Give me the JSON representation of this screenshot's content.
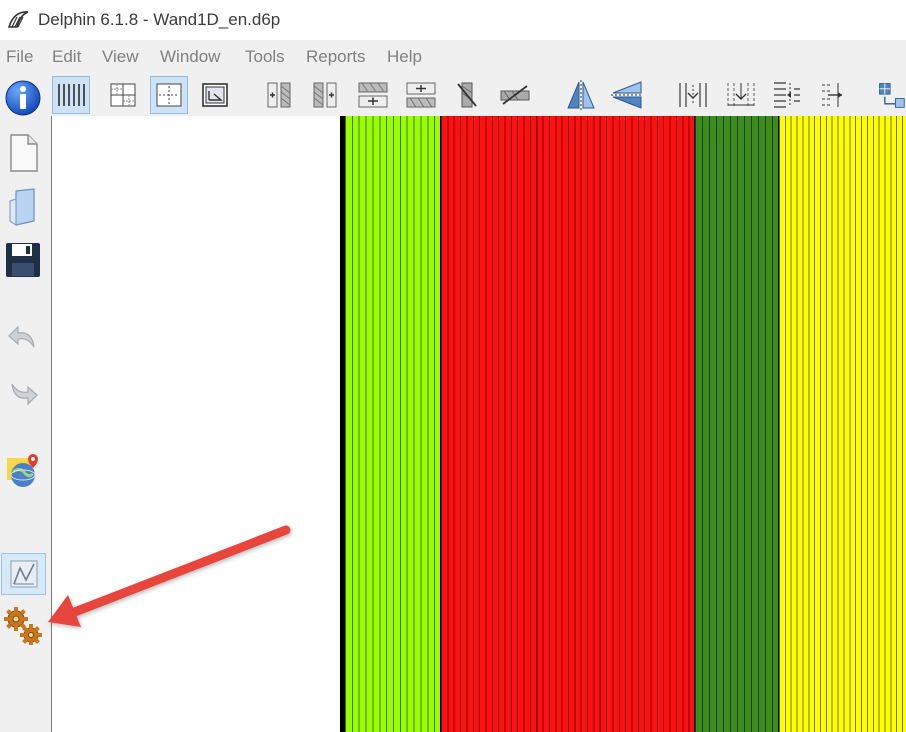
{
  "window": {
    "title": "Delphin 6.1.8 - Wand1D_en.d6p"
  },
  "menu": [
    "File",
    "Edit",
    "View",
    "Window",
    "Tools",
    "Reports",
    "Help"
  ],
  "left_toolbar": [
    {
      "icon": "info-icon"
    },
    {
      "icon": "new-file-icon"
    },
    {
      "icon": "open-file-icon"
    },
    {
      "icon": "save-icon"
    },
    {
      "icon": "undo-icon"
    },
    {
      "icon": "redo-icon"
    },
    {
      "icon": "climate-location-icon"
    },
    {
      "icon": "post-processing-icon",
      "checked": true
    },
    {
      "icon": "settings-gears-icon"
    }
  ],
  "top_toolbar": [
    {
      "icon": "grid-lines-view-icon",
      "checked": true
    },
    {
      "icon": "grid-cells-view-icon"
    },
    {
      "icon": "selection-view-icon",
      "checked": true
    },
    {
      "icon": "assignment-view-icon"
    },
    {
      "icon": "insert-column-icon"
    },
    {
      "icon": "split-column-icon"
    },
    {
      "icon": "insert-row-icon"
    },
    {
      "icon": "split-row-icon"
    },
    {
      "icon": "delete-column-icon"
    },
    {
      "icon": "delete-row-icon"
    },
    {
      "icon": "mirror-horizontal-icon"
    },
    {
      "icon": "mirror-vertical-icon"
    },
    {
      "icon": "refine-columns-icon"
    },
    {
      "icon": "refine-rows-icon"
    },
    {
      "icon": "align-left-icon"
    },
    {
      "icon": "align-right-icon"
    },
    {
      "icon": "more-tools-icon"
    }
  ],
  "layers": [
    {
      "name": "black-boundary-layer",
      "color": "#000000",
      "lines": 0
    },
    {
      "name": "light-green-layer",
      "color": "#99ff00",
      "lines": 14
    },
    {
      "name": "red-layer",
      "color": "#ff1010",
      "lines": 40
    },
    {
      "name": "dark-green-layer",
      "color": "#3c8c1e",
      "lines": 12
    },
    {
      "name": "yellow-layer",
      "color": "#ffff00",
      "lines": 22
    }
  ],
  "annotation": {
    "color": "#e8453c"
  }
}
